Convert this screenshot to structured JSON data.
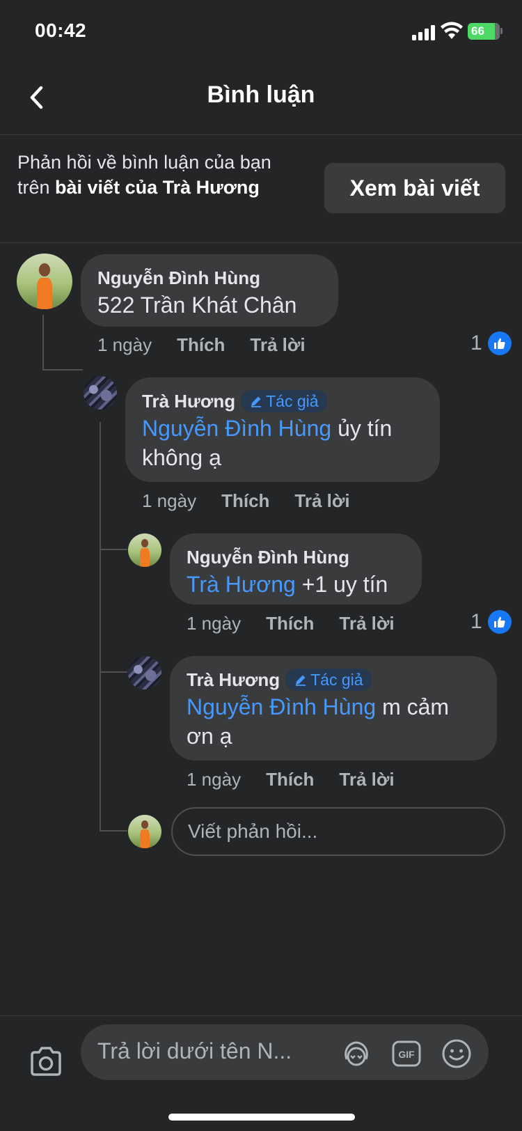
{
  "status_bar": {
    "time": "00:42",
    "battery": "66"
  },
  "header": {
    "title": "Bình luận"
  },
  "context": {
    "text_prefix": "Phản hồi về bình luận của bạn trên ",
    "text_bold_1": "bài viết của",
    "text_mid": " ",
    "text_bold_2": "Trà Hương",
    "view_post_label": "Xem bài viết"
  },
  "comments": [
    {
      "author": "Nguyễn Đình Hùng",
      "mention": "",
      "text": "522 Trần Khát Chân",
      "time": "1 ngày",
      "like_label": "Thích",
      "reply_label": "Trả lời",
      "reactions": "1"
    },
    {
      "author": "Trà Hương",
      "badge": "Tác giả",
      "mention": "Nguyễn Đình Hùng",
      "text": " ủy tín không ạ",
      "time": "1 ngày",
      "like_label": "Thích",
      "reply_label": "Trả lời"
    },
    {
      "author": "Nguyễn Đình Hùng",
      "mention": "Trà Hương",
      "text": " +1 uy tín",
      "time": "1 ngày",
      "like_label": "Thích",
      "reply_label": "Trả lời",
      "reactions": "1"
    },
    {
      "author": "Trà Hương",
      "badge": "Tác giả",
      "mention": "Nguyễn Đình Hùng",
      "text": " m cảm ơn ạ",
      "time": "1 ngày",
      "like_label": "Thích",
      "reply_label": "Trả lời"
    }
  ],
  "reply_input": {
    "placeholder": "Viết phản hồi..."
  },
  "composer": {
    "placeholder": "Trả lời dưới tên N..."
  },
  "colors": {
    "accent": "#4599ff",
    "like_blue": "#1877f2",
    "background": "#242526",
    "bubble": "#3a3b3c"
  },
  "icons": [
    "back-icon",
    "camera-icon",
    "avatar-sticker-icon",
    "gif-icon",
    "emoji-icon",
    "like-icon",
    "pencil-icon"
  ]
}
